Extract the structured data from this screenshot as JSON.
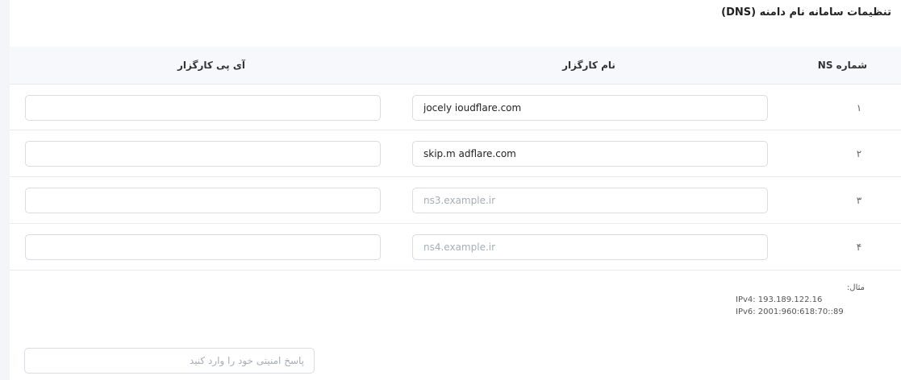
{
  "page_title": "تنظیمات سامانه نام دامنه (DNS)",
  "table": {
    "headers": {
      "number": "شماره NS",
      "server_name": "نام کارگزار",
      "server_ip": "آی پی کارگزار"
    },
    "rows": [
      {
        "number": "۱",
        "name_value": "jocely ioudflare.com",
        "name_placeholder": "",
        "ip_value": "",
        "ip_placeholder": ""
      },
      {
        "number": "۲",
        "name_value": "skip.m adflare.com",
        "name_placeholder": "",
        "ip_value": "",
        "ip_placeholder": ""
      },
      {
        "number": "۳",
        "name_value": "",
        "name_placeholder": "ns3.example.ir",
        "ip_value": "",
        "ip_placeholder": ""
      },
      {
        "number": "۴",
        "name_value": "",
        "name_placeholder": "ns4.example.ir",
        "ip_value": "",
        "ip_placeholder": ""
      }
    ]
  },
  "example": {
    "label": "مثال:",
    "ipv4": "IPv4: 193.189.122.16",
    "ipv6": "IPv6: 2001:960:618:70::89"
  },
  "security": {
    "value": "",
    "placeholder": "پاسخ امنیتی خود را وارد کنید"
  }
}
